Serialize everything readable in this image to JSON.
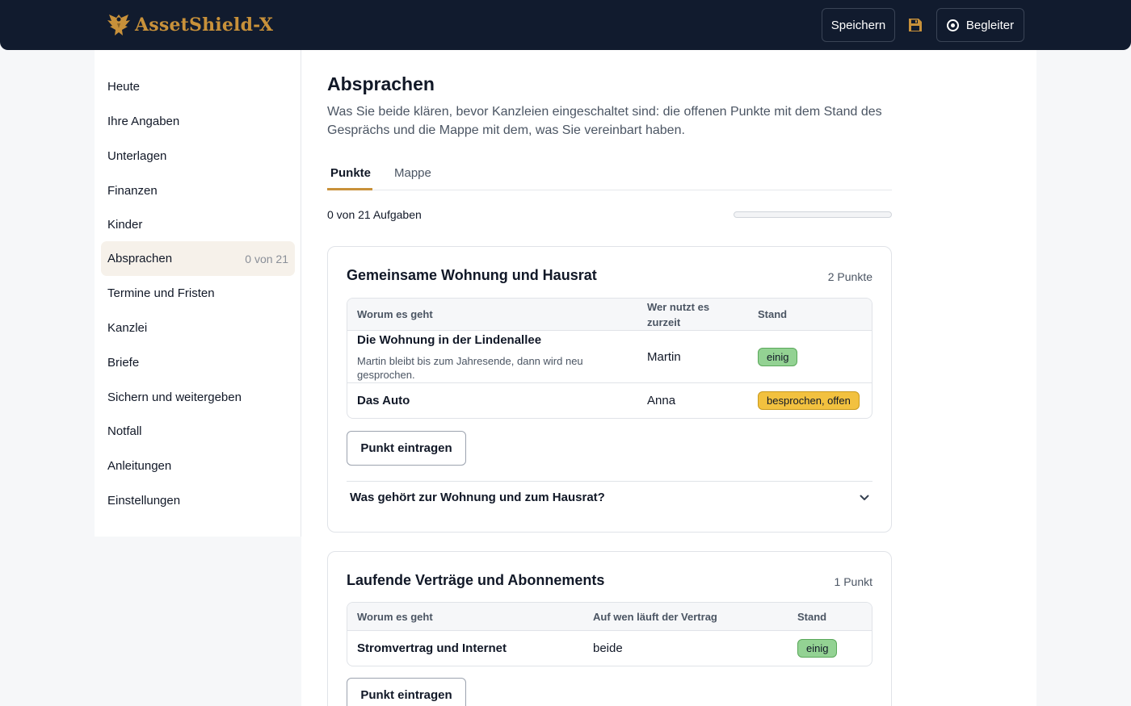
{
  "header": {
    "brand": "AssetShield-X",
    "save_label": "Speichern",
    "guide_label": "Begleiter",
    "icons": {
      "logo": "eagle-logo-icon",
      "save": "floppy-disk-icon",
      "guide": "target-circle-icon"
    },
    "colors": {
      "background": "#111b2e",
      "brand": "#c8913a"
    }
  },
  "sidebar": {
    "items": [
      {
        "label": "Heute"
      },
      {
        "label": "Ihre Angaben"
      },
      {
        "label": "Unterlagen"
      },
      {
        "label": "Finanzen"
      },
      {
        "label": "Kinder"
      },
      {
        "label": "Absprachen",
        "badge": "0 von 21",
        "active": true
      },
      {
        "label": "Termine und Fristen"
      },
      {
        "label": "Kanzlei"
      },
      {
        "label": "Briefe"
      },
      {
        "label": "Sichern und weitergeben"
      },
      {
        "label": "Notfall"
      },
      {
        "label": "Anleitungen"
      },
      {
        "label": "Einstellungen"
      }
    ]
  },
  "main": {
    "title": "Absprachen",
    "description": "Was Sie beide klären, bevor Kanzleien eingeschaltet sind: die offenen Punkte mit dem Stand des Gesprächs und die Mappe mit dem, was Sie vereinbart haben.",
    "tabs": [
      {
        "label": "Punkte",
        "active": true
      },
      {
        "label": "Mappe"
      }
    ],
    "progress": {
      "text": "0 von 21 Aufgaben",
      "done": 0,
      "total": 21
    },
    "sections": [
      {
        "title": "Gemeinsame Wohnung und Hausrat",
        "count": "2 Punkte",
        "columns": [
          "Worum es geht",
          "Wer nutzt es zurzeit",
          "Stand"
        ],
        "rows": [
          {
            "title": "Die Wohnung in der Lindenallee",
            "note": "Martin bleibt bis zum Jahresende, dann wird neu gesprochen.",
            "person": "Martin",
            "status": "einig",
            "status_color": "#93d293"
          },
          {
            "title": "Das Auto",
            "person": "Anna",
            "status": "besprochen, offen",
            "status_color": "#f2c13f"
          }
        ],
        "add_label": "Punkt eintragen",
        "faq": "Was gehört zur Wohnung und zum Hausrat?"
      },
      {
        "title": "Laufende Verträge und Abonnements",
        "count": "1 Punkt",
        "columns": [
          "Worum es geht",
          "Auf wen läuft der Vertrag",
          "Stand"
        ],
        "rows": [
          {
            "title": "Stromvertrag und Internet",
            "person": "beide",
            "status": "einig",
            "status_color": "#93d293"
          }
        ],
        "add_label": "Punkt eintragen"
      }
    ]
  }
}
